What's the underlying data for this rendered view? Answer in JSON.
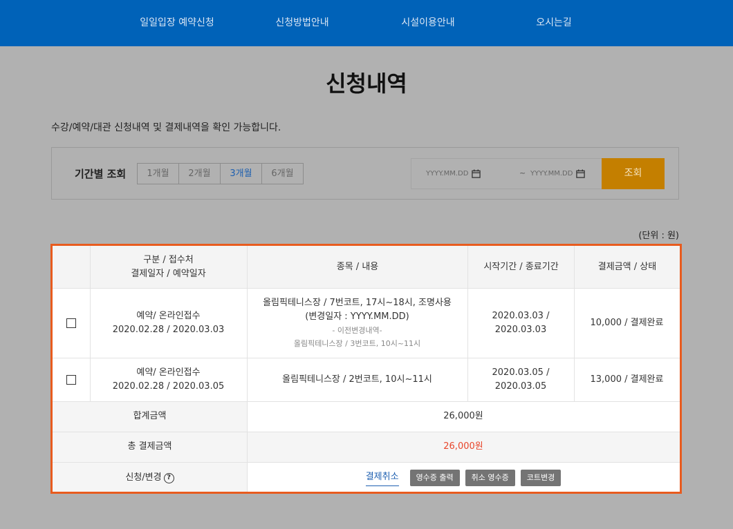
{
  "nav": {
    "items": [
      "일일입장 예약신청",
      "신청방법안내",
      "시설이용안내",
      "오시는길"
    ]
  },
  "page": {
    "title": "신청내역",
    "intro": "수강/예약/대관 신청내역 및 결제내역을 확인 가능합니다."
  },
  "filter": {
    "label": "기간별 조회",
    "periods": [
      "1개월",
      "2개월",
      "3개월",
      "6개월"
    ],
    "active_period": "3개월",
    "start_placeholder": "YYYY.MM.DD",
    "tilde": "~",
    "end_placeholder": "YYYY.MM.DD",
    "search_label": "조회"
  },
  "unit_label": "(단위 : 원)",
  "table": {
    "headers": {
      "col1_line1": "구분 / 접수처",
      "col1_line2": "결제일자 / 예약일자",
      "col2": "종목 / 내용",
      "col3": "시작기간 / 종료기간",
      "col4": "결제금액 / 상태"
    },
    "rows": [
      {
        "type": "예약/ 온라인접수",
        "dates": "2020.02.28 / 2020.03.03",
        "content_line1": "올림픽테니스장 / 7번코트, 17시~18시, 조명사용",
        "content_line2": "(변경일자 : YYYY.MM.DD)",
        "note_line1": "- 이전변경내역-",
        "note_line2": "올림픽테니스장 / 3번코트, 10시~11시",
        "period_start": "2020.03.03 /",
        "period_end": "2020.03.03",
        "amount_status": "10,000 / 결제완료"
      },
      {
        "type": "예약/ 온라인접수",
        "dates": "2020.02.28 / 2020.03.05",
        "content_line1": "올림픽테니스장 / 2번코트, 10시~11시",
        "period_start": "2020.03.05 /",
        "period_end": "2020.03.05",
        "amount_status": "13,000 / 결제완료"
      }
    ],
    "sum_label": "합계금액",
    "sum_value": "26,000원",
    "total_label": "총 결제금액",
    "total_value": "26,000원",
    "action_label": "신청/변경",
    "help_glyph": "?",
    "actions": {
      "cancel_payment": "결제취소",
      "print_receipt": "영수증 출력",
      "cancel_receipt": "취소 영수증",
      "change_court": "코트변경"
    }
  },
  "colors": {
    "nav_bg": "#0062b8",
    "search_btn": "#c47f00",
    "highlight_border": "#e85b1e",
    "total_text": "#e8452a",
    "link": "#1d5fb0"
  }
}
